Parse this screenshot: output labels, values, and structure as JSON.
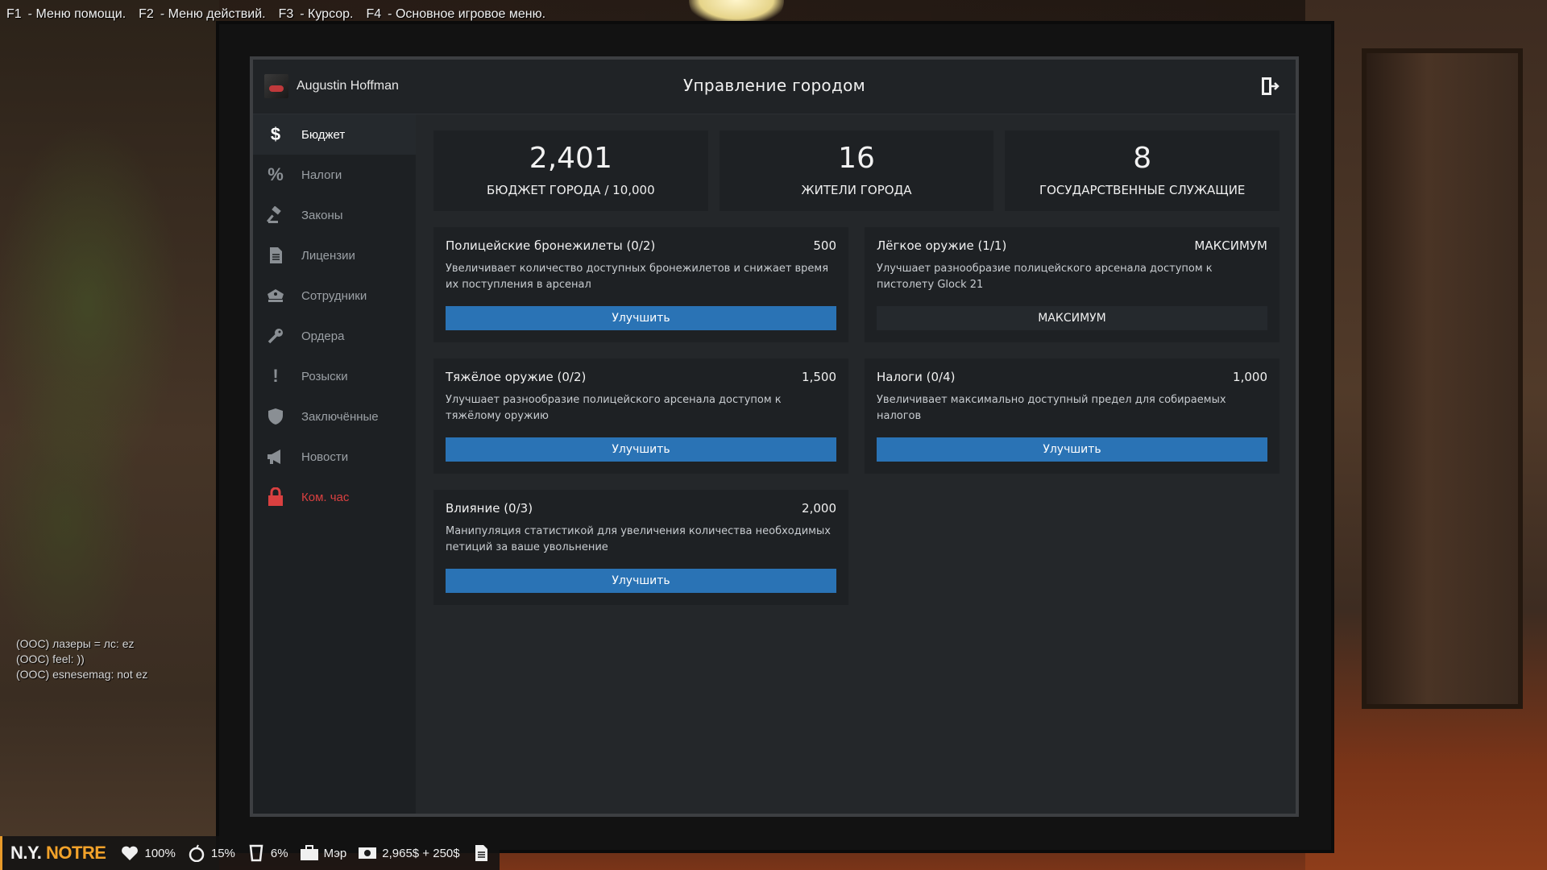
{
  "help_bar": [
    {
      "key": "F1",
      "desc": "- Меню помощи."
    },
    {
      "key": "F2",
      "desc": "- Меню действий."
    },
    {
      "key": "F3",
      "desc": "- Курсор."
    },
    {
      "key": "F4",
      "desc": "- Основное игровое меню."
    }
  ],
  "header": {
    "user_name": "Augustin Hoffman",
    "title": "Управление городом",
    "exit_icon": "exit-door-icon"
  },
  "sidebar": {
    "items": [
      {
        "label": "Бюджет",
        "icon": "dollar-icon",
        "active": true
      },
      {
        "label": "Налоги",
        "icon": "percent-icon"
      },
      {
        "label": "Законы",
        "icon": "gavel-icon"
      },
      {
        "label": "Лицензии",
        "icon": "document-icon"
      },
      {
        "label": "Сотрудники",
        "icon": "police-hat-icon"
      },
      {
        "label": "Ордера",
        "icon": "key-icon"
      },
      {
        "label": "Розыски",
        "icon": "exclamation-icon"
      },
      {
        "label": "Заключённые",
        "icon": "shield-icon"
      },
      {
        "label": "Новости",
        "icon": "megaphone-icon"
      },
      {
        "label": "Ком. час",
        "icon": "lock-icon",
        "danger": true
      }
    ]
  },
  "stats": [
    {
      "value": "2,401",
      "label": "БЮДЖЕТ ГОРОДА / 10,000"
    },
    {
      "value": "16",
      "label": "ЖИТЕЛИ ГОРОДА"
    },
    {
      "value": "8",
      "label": "ГОСУДАРСТВЕННЫЕ СЛУЖАЩИЕ"
    }
  ],
  "upgrades": [
    {
      "title": "Полицейские бронежилеты (0/2)",
      "cost": "500",
      "desc": "Увеличивает количество доступных бронежилетов и снижает время их поступления в арсенал",
      "button": "Улучшить"
    },
    {
      "title": "Лёгкое оружие (1/1)",
      "cost": "МАКСИМУМ",
      "desc": "Улучшает разнообразие полицейского арсенала доступом к пистолету Glock 21",
      "button": "МАКСИМУМ",
      "maxed": true
    },
    {
      "title": "Тяжёлое оружие (0/2)",
      "cost": "1,500",
      "desc": "Улучшает разнообразие полицейского арсенала доступом к тяжёлому оружию",
      "button": "Улучшить"
    },
    {
      "title": "Налоги (0/4)",
      "cost": "1,000",
      "desc": "Увеличивает максимально доступный предел для собираемых налогов",
      "button": "Улучшить"
    },
    {
      "title": "Влияние (0/3)",
      "cost": "2,000",
      "desc": "Манипуляция статистикой для увеличения количества необходимых петиций за ваше увольнение",
      "button": "Улучшить"
    }
  ],
  "chat": [
    "(OOC) лазеры = лс: ez",
    "(OOC) feel: ))",
    "(OOC) esnesemag: not ez"
  ],
  "hud": {
    "brand_left": "N.Y.",
    "brand_right": "NOTRE",
    "health": "100%",
    "hunger": "15%",
    "armor": "6%",
    "job": "Мэр",
    "money": "2,965$ + 250$"
  },
  "colors": {
    "accent_button": "#2a73b5",
    "danger": "#d94040",
    "panel_bg": "#24272a",
    "card_bg": "#1e2124",
    "brand_orange": "#f2a22a"
  }
}
